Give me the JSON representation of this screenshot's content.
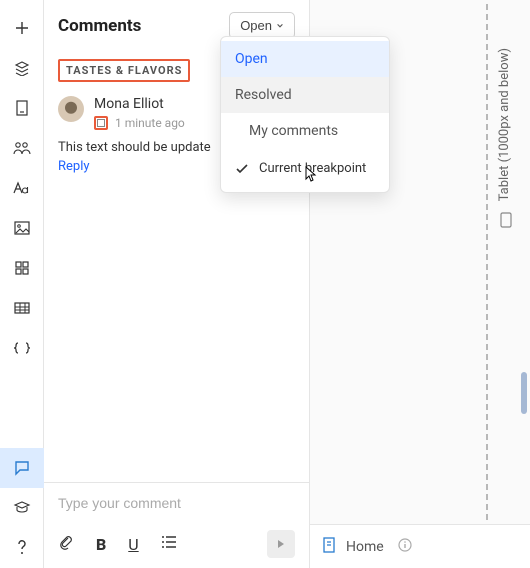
{
  "panel": {
    "title": "Comments",
    "filter_button": "Open"
  },
  "dropdown": {
    "items": [
      "Open",
      "Resolved",
      "My comments"
    ],
    "toggle_label": "Current breakpoint"
  },
  "thread": {
    "section_label": "TASTES & FLAVORS",
    "author": "Mona Elliot",
    "timestamp": "1 minute ago",
    "body": "This text should be update",
    "reply_label": "Reply"
  },
  "composer": {
    "placeholder": "Type your comment"
  },
  "canvas": {
    "breakpoint_label": "Tablet (1000px and below)"
  },
  "bottom_bar": {
    "page_name": "Home"
  }
}
